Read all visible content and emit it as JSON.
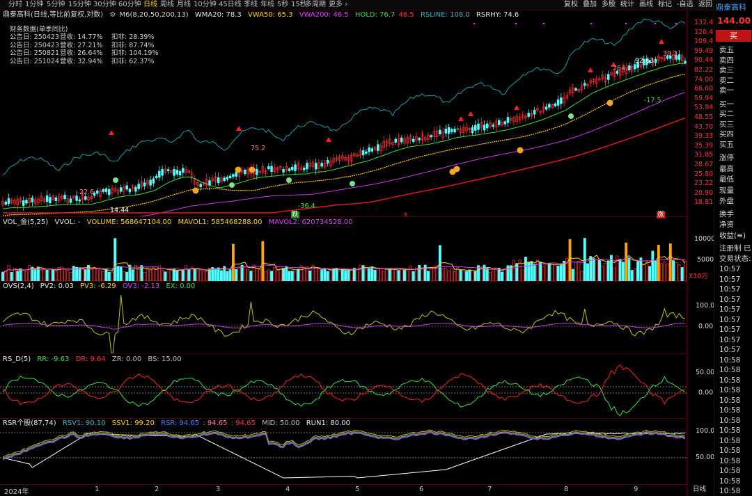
{
  "toolbar": {
    "periods": [
      "分时",
      "1分钟",
      "5分钟",
      "15分钟",
      "30分钟",
      "60分钟",
      "日线",
      "周线",
      "月线",
      "10分钟",
      "45日线",
      "季线",
      "年线",
      "5秒",
      "15秒",
      "多周期",
      "更多 ›"
    ],
    "active": "日线",
    "right": [
      "复权",
      "叠加",
      "多股",
      "统计",
      "画线",
      "标记",
      "-自选",
      "返回"
    ]
  },
  "main": {
    "title": "鼎泰高科(日线,等比前复权,对数)",
    "indicator": "M6(8,20,50,200,13)",
    "wma20": "WMA20: 78.3",
    "vwa50": "VWA50: 65.3",
    "vwa200": "VWA200: 46.5",
    "hold": "HOLD: 76.7",
    "hold2": "46.5",
    "rsline": "RSLINE: 108.0",
    "rsrhy": "RSRHY: 74.6",
    "fin_title": "财务数据(单季同比)",
    "fin_rows": [
      {
        "a": "公告日: 250423",
        "b": "营收:  14.77%",
        "c": "扣非:  28.39%"
      },
      {
        "a": "公告日: 250423",
        "b": "营收:  27.21%",
        "c": "扣非:  87.74%"
      },
      {
        "a": "公告日: 250821",
        "b": "营收:  26.64%",
        "c": "扣非: 104.19%"
      },
      {
        "a": "公告日: 251024",
        "b": "营收:  32.94%",
        "c": "扣非:  62.37%"
      }
    ],
    "yaxis": [
      "132.4",
      "120.4",
      "109.4",
      "99.49",
      "90.44",
      "82.22",
      "74.00",
      "66.60",
      "59.94",
      "53.94",
      "48.55",
      "43.70",
      "39.33",
      "35.39",
      "31.85",
      "28.67",
      "25.80",
      "23.22",
      "20.90",
      "18.81"
    ],
    "marks": {
      "m1": "22.6",
      "m2": "14.44",
      "m3": "75.2",
      "m4": "-36.4",
      "m5": "92.63",
      "m6": "39.1",
      "m7": "264.9",
      "m8": "-17.5",
      "die": "跌",
      "zhang": "涨",
      "s": "s"
    }
  },
  "vol": {
    "name": "VOL_金(5,25)",
    "vvol": "VVOL: -",
    "volume": "VOLUME: 568647104.00",
    "mavol1": "MAVOL1: 585468288.00",
    "mavol2": "MAVOL2: 620734528.00",
    "yaxis": [
      "10000",
      "5000"
    ],
    "unit": "X10万"
  },
  "ovs": {
    "name": "OVS(2,4)",
    "pv2": "PV2: 0.03",
    "pv3": "PV3: -6.29",
    "ov3": "OV3: -2.13",
    "ex": "EX: 0.00",
    "yaxis": [
      "100.0",
      "0.00"
    ]
  },
  "rsd": {
    "name": "RS_D(5)",
    "rr": "RR: -9.63",
    "dr": "DR: 9.64",
    "zr": "ZR: 0.00",
    "bs": "BS: 15.00",
    "yaxis": [
      "50.00",
      "0.00"
    ]
  },
  "rsr": {
    "name": "RSR个股(87,74)",
    "rsv1": "RSV1: 90.10",
    "ssv1": "SSV1: 99.20",
    "rsr": "RSR: 94.65",
    "rsr2": ": 94.65",
    "rsr3": ": 94.65",
    "mid": "MID: 50.00",
    "run1": "RUN1: 80.00",
    "yaxis": [
      "100.0",
      "50.00"
    ]
  },
  "xaxis": [
    "2024年",
    "1",
    "2",
    "3",
    "4",
    "5",
    "6",
    "7",
    "8",
    "9"
  ],
  "xunit": "日线",
  "side": {
    "name": "鼎泰高科",
    "price": "144.00",
    "buy": "买",
    "asks": [
      "卖五",
      "卖四",
      "卖三",
      "卖二",
      "卖一"
    ],
    "bids": [
      "买一",
      "买二",
      "买三",
      "买四",
      "买五"
    ],
    "stats": [
      "涨停",
      "最高",
      "最低",
      "现量",
      "外盘"
    ],
    "stats2": [
      "换手",
      "净资",
      "收益(≡)"
    ],
    "reg": "注册制 已",
    "trade": "交易状态:",
    "times": [
      "10:57",
      "10:57",
      "10:57",
      "10:57",
      "10:57",
      "10:57",
      "10:57",
      "10:57",
      "10:57",
      "10:58",
      "10:58",
      "10:58",
      "10:58",
      "10:58",
      "10:58",
      "10:58",
      "10:58",
      "10:58",
      "10:58",
      "10:58",
      "10:58",
      "10:58",
      "10:58",
      "10:58",
      "10:58",
      "10:58",
      "10:58",
      "10:58"
    ]
  },
  "colors": {
    "up": "#ff3232",
    "down": "#54ffff",
    "accent": "#ffd500",
    "magenta": "#e040fb",
    "bg": "#000000"
  }
}
